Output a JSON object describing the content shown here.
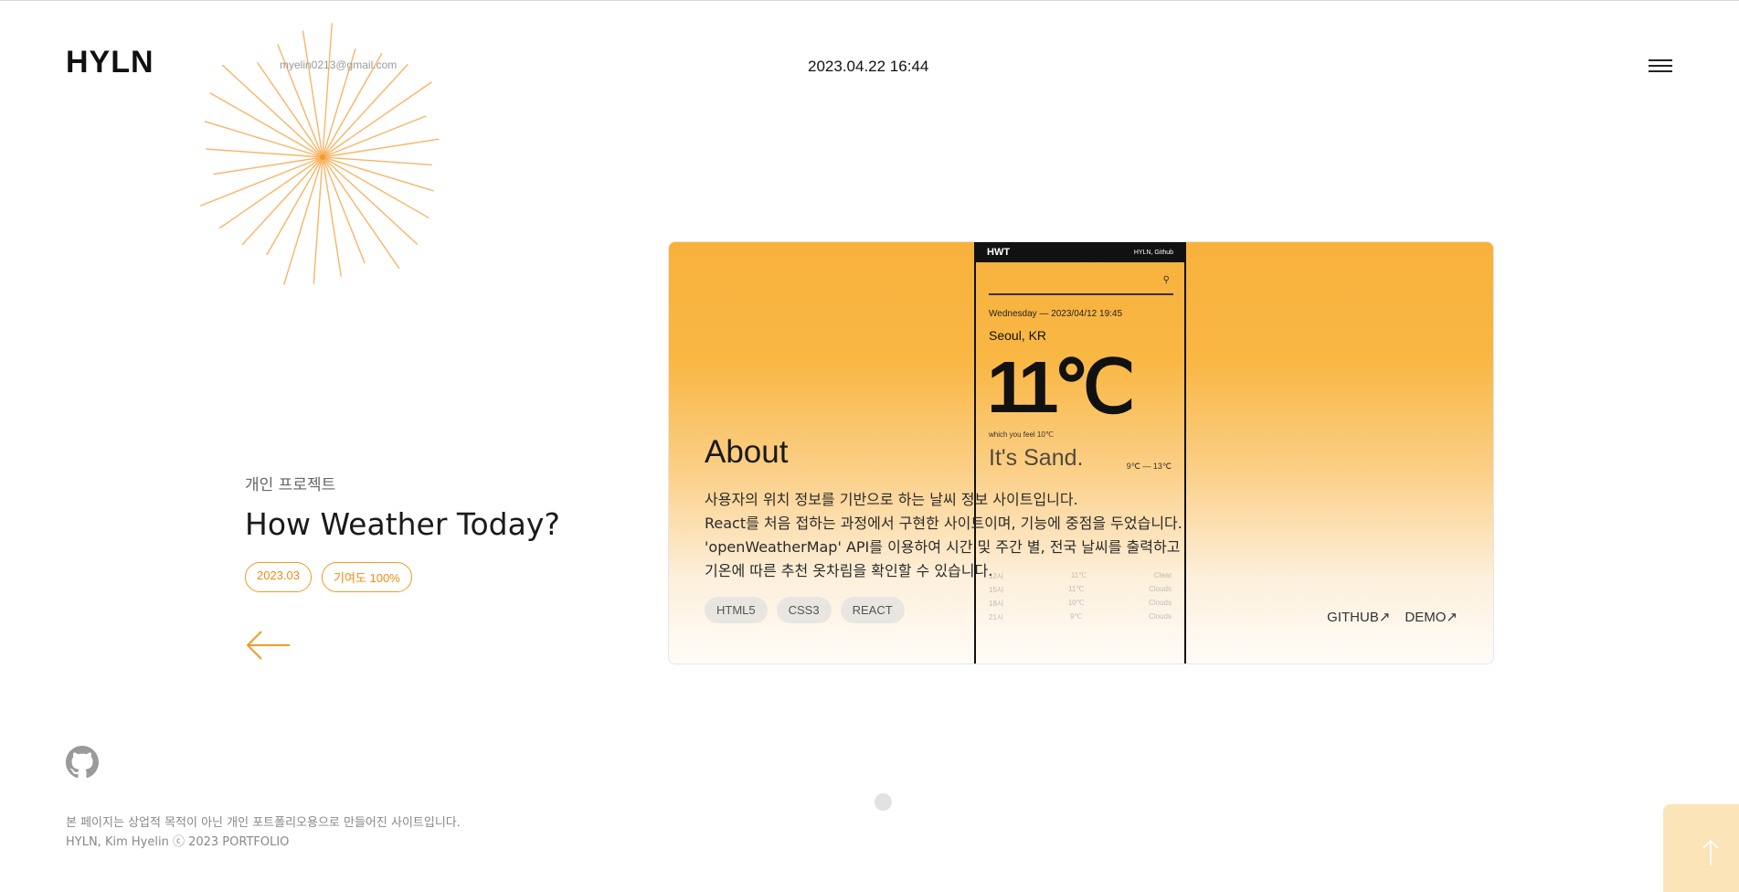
{
  "header": {
    "logo": "HYLN",
    "email": "myelin0213@gmail.com",
    "datetime": "2023.04.22  16:44"
  },
  "project": {
    "subtitle": "개인 프로젝트",
    "title": "How Weather Today?",
    "chips": [
      "2023.03",
      "기여도 100%"
    ]
  },
  "card": {
    "preview": {
      "app_name": "HWT",
      "app_link": "HYLN, Github",
      "date": "Wednesday  —  2023/04/12 19:45",
      "city": "Seoul, KR",
      "temp": "11℃",
      "feel": "which you feel 10℃",
      "status": "It's Sand.",
      "range": "9℃ — 13℃",
      "rows": [
        [
          "12시",
          "11℃",
          "Clear"
        ],
        [
          "15시",
          "11℃",
          "Clouds"
        ],
        [
          "18시",
          "10℃",
          "Clouds"
        ],
        [
          "21시",
          "9℃",
          "Clouds"
        ]
      ]
    },
    "about_title": "About",
    "description": [
      "사용자의 위치 정보를 기반으로 하는 날씨 정보 사이트입니다.",
      "React를 처음 접하는 과정에서 구현한 사이트이며, 기능에 중점을 두었습니다.",
      "'openWeatherMap' API를 이용하여 시간 및 주간 별, 전국 날씨를 출력하고",
      "기온에 따른 추천 옷차림을 확인할 수 있습니다."
    ],
    "tags": [
      "HTML5",
      "CSS3",
      "REACT"
    ],
    "links": [
      "GITHUB↗",
      "DEMO↗"
    ]
  },
  "footer": {
    "line1": "본 페이지는 상업적 목적이 아닌 개인 포트폴리오용으로 만들어진 사이트입니다.",
    "line2": "HYLN, Kim Hyelin ⓒ 2023 PORTFOLIO"
  },
  "colors": {
    "accent": "#f29a24",
    "card_top": "#f8b13c",
    "top_button": "#fbe4b8"
  }
}
